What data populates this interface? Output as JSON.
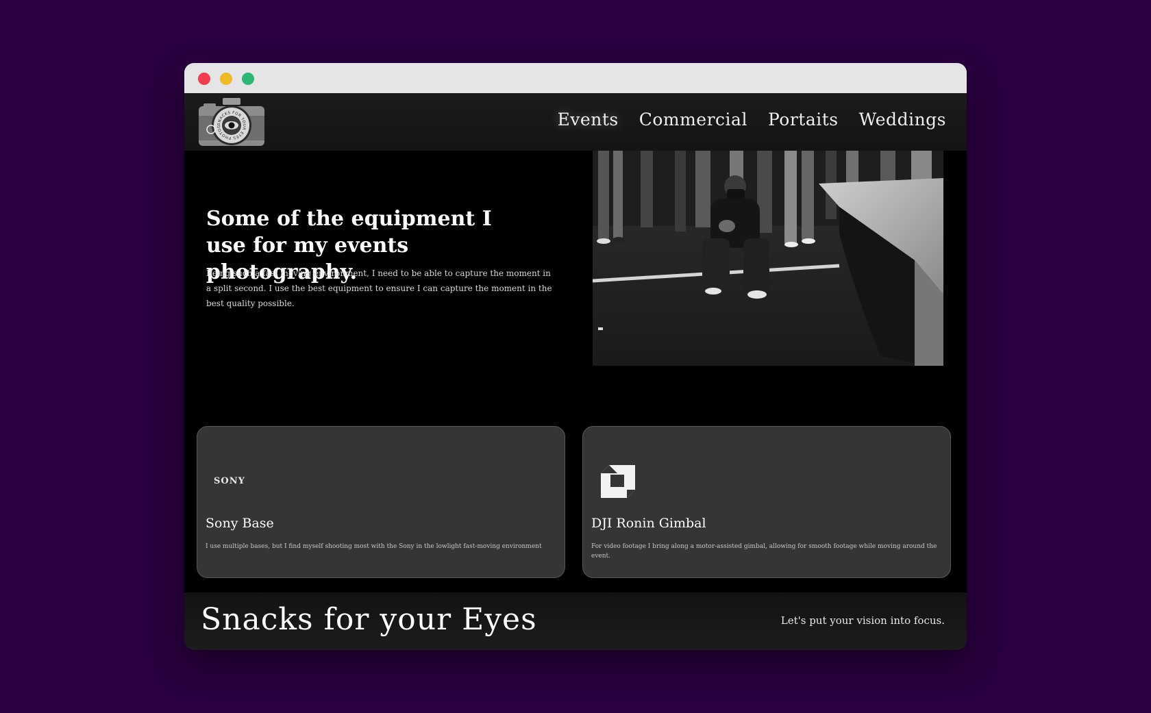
{
  "nav": {
    "items": [
      {
        "label": "Events"
      },
      {
        "label": "Commercial"
      },
      {
        "label": "Portaits"
      },
      {
        "label": "Weddings"
      }
    ]
  },
  "hero": {
    "title": "Some of the equipment I use for my events photography.",
    "description": "Being such a fast moving environment, I need to be able to capture the moment in a split second. I use the best equipment to ensure I can capture the moment in the best quality possible."
  },
  "logo": {
    "icon": "camera-icon",
    "ring_text": "SNACKS FOR YOUR EYES PHOTOGRAPHY"
  },
  "cards": [
    {
      "logo_text": "SONY",
      "title": "Sony Base",
      "text": "I use multiple bases, but I find myself shooting most with the Sony in the lowlight fast-moving environment"
    },
    {
      "logo_icon": "dji-logo-icon",
      "title": "DJI Ronin Gimbal",
      "text": "For video footage I bring along a motor-assisted gimbal, allowing for smooth footage while moving around the event."
    }
  ],
  "footer": {
    "brand": "Snacks for your Eyes",
    "tagline": "Let's put your vision into focus."
  },
  "colors": {
    "page_background": "#2a0040",
    "site_background": "#000000",
    "card_background": "#353535",
    "header_background": "#1b1b1b",
    "traffic_red": "#f03e50",
    "traffic_yellow": "#f0b928",
    "traffic_green": "#2bb673"
  }
}
